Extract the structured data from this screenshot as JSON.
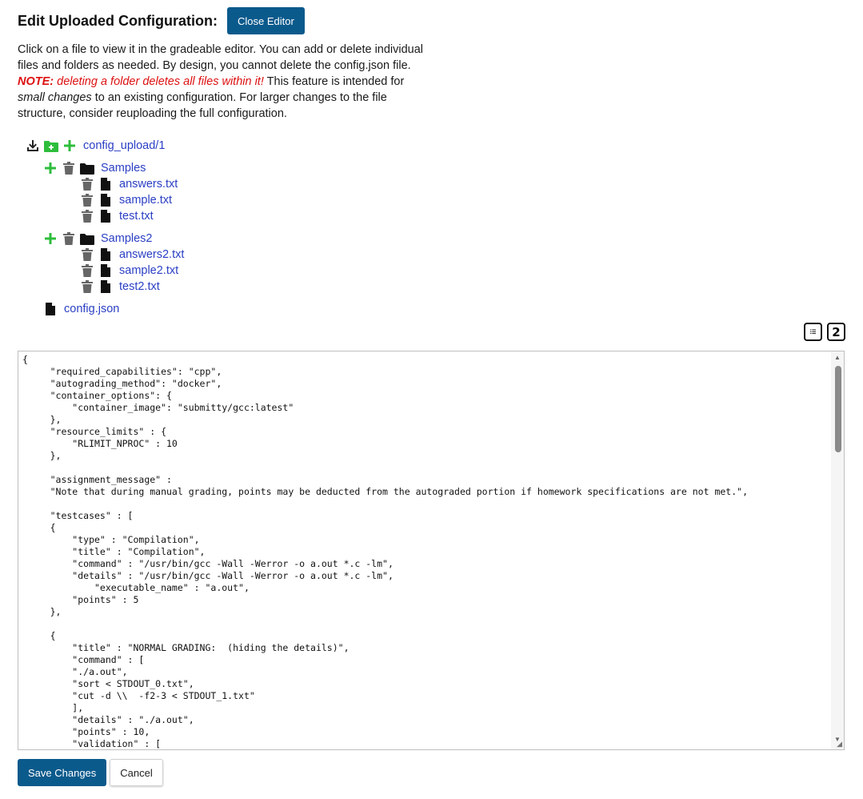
{
  "header": {
    "title": "Edit Uploaded Configuration:",
    "close_label": "Close Editor"
  },
  "description": {
    "p1": "Click on a file to view it in the gradeable editor. You can add or delete individual files and folders as needed. By design, you cannot delete the config.json file. ",
    "note_bold": "NOTE:",
    "note_text": " deleting a folder deletes all files within it!",
    "p2": " This feature is intended for ",
    "em": "small changes",
    "p3": " to an existing configuration. For larger changes to the file structure, consider reuploading the full configuration."
  },
  "tree": {
    "root": "config_upload/1",
    "folders": [
      {
        "name": "Samples",
        "files": [
          "answers.txt",
          "sample.txt",
          "test.txt"
        ]
      },
      {
        "name": "Samples2",
        "files": [
          "answers2.txt",
          "sample2.txt",
          "test2.txt"
        ]
      }
    ],
    "root_file": "config.json"
  },
  "toolbar": {
    "mode_icon": "list-ordered-icon",
    "second_label": "2"
  },
  "editor": {
    "content": "{\n     \"required_capabilities\": \"cpp\",\n     \"autograding_method\": \"docker\",\n     \"container_options\": {\n         \"container_image\": \"submitty/gcc:latest\"\n     },\n     \"resource_limits\" : {\n         \"RLIMIT_NPROC\" : 10\n     },\n\n     \"assignment_message\" :\n     \"Note that during manual grading, points may be deducted from the autograded portion if homework specifications are not met.\",\n\n     \"testcases\" : [\n     {\n         \"type\" : \"Compilation\",\n         \"title\" : \"Compilation\",\n         \"command\" : \"/usr/bin/gcc -Wall -Werror -o a.out *.c -lm\",\n         \"details\" : \"/usr/bin/gcc -Wall -Werror -o a.out *.c -lm\",\n             \"executable_name\" : \"a.out\",\n         \"points\" : 5\n     },\n\n     {\n         \"title\" : \"NORMAL GRADING:  (hiding the details)\",\n         \"command\" : [\n         \"./a.out\",\n         \"sort < STDOUT_0.txt\",\n         \"cut -d \\\\  -f2-3 < STDOUT_1.txt\"\n         ],\n         \"details\" : \"./a.out\",\n         \"points\" : 10,\n         \"validation\" : ["
  },
  "footer": {
    "save_label": "Save Changes",
    "cancel_label": "Cancel"
  },
  "colors": {
    "primary": "#0b5a8c",
    "link": "#2a3fc4",
    "add": "#2ebd3c",
    "note": "#dd1111"
  }
}
